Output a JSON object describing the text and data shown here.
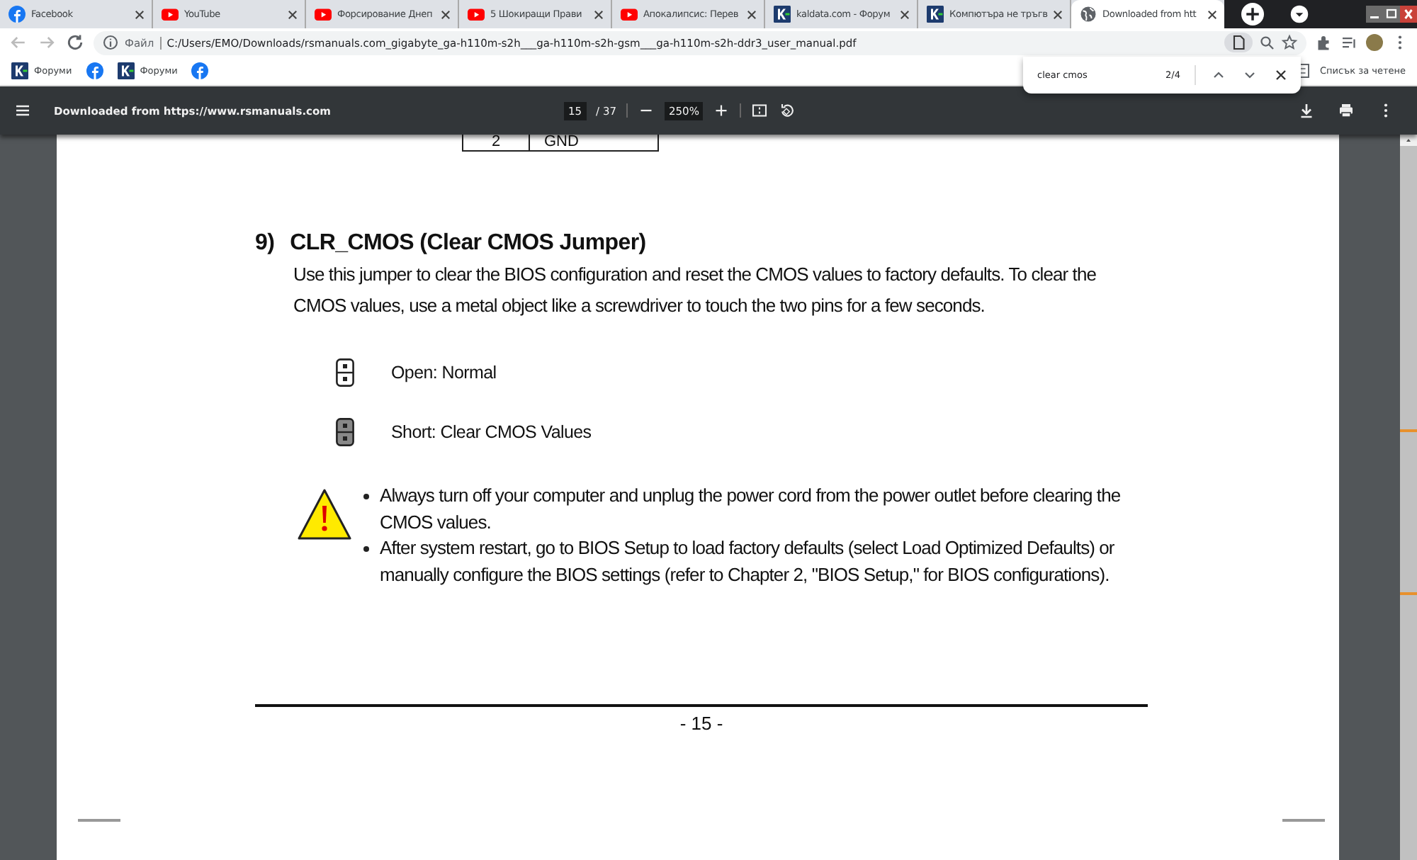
{
  "tabs": [
    {
      "kind": "facebook",
      "title": "Facebook",
      "selected": false
    },
    {
      "kind": "youtube",
      "title": "YouTube",
      "selected": false
    },
    {
      "kind": "youtube",
      "title": "Форсирование Днеп",
      "selected": false
    },
    {
      "kind": "youtube",
      "title": "5 Шокиращи Прави",
      "selected": false
    },
    {
      "kind": "youtube",
      "title": "Апокалипсис: Перев",
      "selected": false
    },
    {
      "kind": "kaldata",
      "title": "kaldata.com - Форум",
      "selected": false
    },
    {
      "kind": "kaldata",
      "title": "Компютъра не тръгв",
      "selected": false
    },
    {
      "kind": "globe",
      "title": "Downloaded from htt",
      "selected": true
    }
  ],
  "address_bar": {
    "scheme_label": "Файл",
    "url": "C:/Users/EMO/Downloads/rsmanuals.com_gigabyte_ga-h110m-s2h___ga-h110m-s2h-gsm___ga-h110m-s2h-ddr3_user_manual.pdf"
  },
  "bookmarks": [
    {
      "kind": "kaldata",
      "label": "Форуми"
    },
    {
      "kind": "facebook"
    },
    {
      "kind": "kaldata",
      "label": "Форуми"
    },
    {
      "kind": "facebook"
    }
  ],
  "reading_list": {
    "label": "Списък за четене"
  },
  "find_bar": {
    "query": "clear cmos",
    "count": "2/4"
  },
  "pdf_toolbar": {
    "title": "Downloaded from https://www.rsmanuals.com",
    "page": "15",
    "page_total": "/ 37",
    "zoom": "250%"
  },
  "document": {
    "table_row": [
      "2",
      "GND"
    ],
    "heading_number": "9)",
    "heading": "CLR_CMOS (Clear CMOS Jumper)",
    "intro": "Use this jumper to clear the BIOS configuration and reset the CMOS values to factory defaults. To clear the CMOS values, use a metal object like a screwdriver to touch the two pins for a few seconds.",
    "jumper_states": [
      {
        "shorted": false,
        "label": "Open: Normal"
      },
      {
        "shorted": true,
        "label": "Short: Clear CMOS Values"
      }
    ],
    "warnings": [
      "Always turn off your computer and unplug the power cord from the power outlet before clearing the CMOS values.",
      "After system restart, go to BIOS Setup to load factory defaults (select Load Optimized Defaults) or manually configure the BIOS settings (refer to Chapter 2, \"BIOS Setup,\" for BIOS configurations)."
    ],
    "page_number": "- 15 -"
  }
}
